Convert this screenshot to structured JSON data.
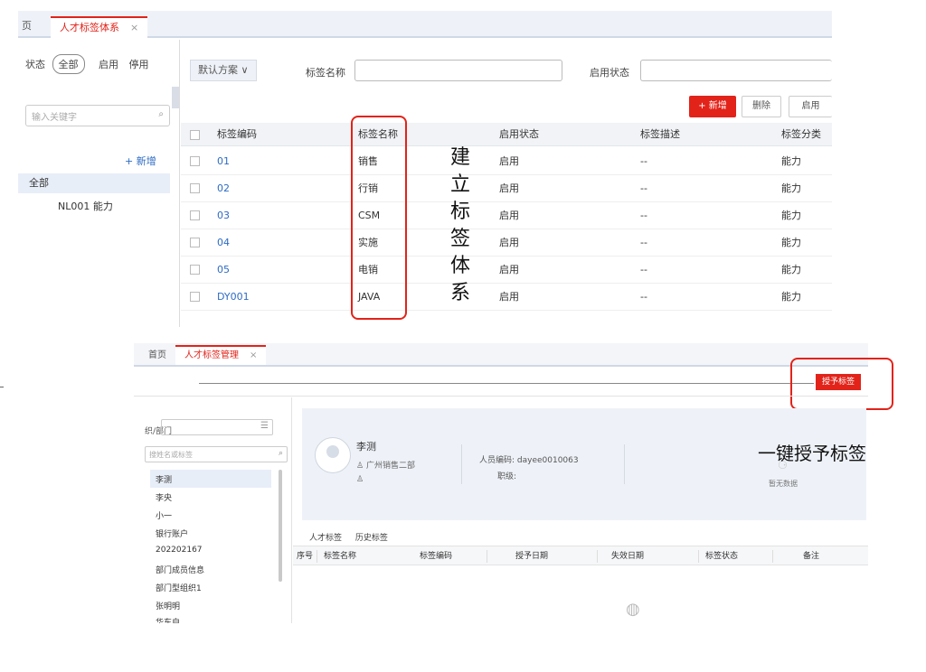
{
  "top": {
    "tabs": [
      {
        "label": "页"
      },
      {
        "label": "人才标签体系",
        "close": "×"
      }
    ],
    "sidebar": {
      "status_label": "状态",
      "status_options": [
        "全部",
        "启用",
        "停用"
      ],
      "search_placeholder": "输入关键字",
      "add_label": "+ 新增",
      "tree_root": "全部",
      "tree_child": "NL001 能力"
    },
    "filters": {
      "plan": "默认方案 ∨",
      "tag_name_label": "标签名称",
      "status_label": "启用状态"
    },
    "toolbar": {
      "new_label": "+ 新增",
      "delete_label": "删除",
      "enable_label": "启用"
    },
    "table": {
      "headers": [
        "标签编码",
        "标签名称",
        "启用状态",
        "标签描述",
        "标签分类"
      ],
      "rows": [
        {
          "code": "01",
          "name": "销售",
          "status": "启用",
          "desc": "--",
          "category": "能力"
        },
        {
          "code": "02",
          "name": "行销",
          "status": "启用",
          "desc": "--",
          "category": "能力"
        },
        {
          "code": "03",
          "name": "CSM",
          "status": "启用",
          "desc": "--",
          "category": "能力"
        },
        {
          "code": "04",
          "name": "实施",
          "status": "启用",
          "desc": "--",
          "category": "能力"
        },
        {
          "code": "05",
          "name": "电销",
          "status": "启用",
          "desc": "--",
          "category": "能力"
        },
        {
          "code": "DY001",
          "name": "JAVA",
          "status": "启用",
          "desc": "--",
          "category": "能力"
        }
      ]
    },
    "annotation_vertical": [
      "建",
      "立",
      "标",
      "签",
      "体",
      "系"
    ]
  },
  "bottom": {
    "tabs": [
      {
        "label": "首页"
      },
      {
        "label": "人才标签管理",
        "close": "×"
      }
    ],
    "grant_button": "授予标签",
    "sidebar": {
      "dept_label": "织/部门",
      "search_placeholder": "搜姓名或标签",
      "people": [
        "李测",
        "李央",
        "小一",
        "银行账户",
        "202202167",
        "部门成员信息",
        "部门型组织1",
        "张明明",
        "华东自"
      ]
    },
    "profile": {
      "name": "李测",
      "dept": "广州销售二部",
      "code": "人员编码: dayee0010063",
      "level": "职级:",
      "no_data": "暂无数据"
    },
    "tabs2": [
      "人才标签",
      "历史标签"
    ],
    "table_headers": [
      "序号",
      "标签名称",
      "标签编码",
      "授予日期",
      "失效日期",
      "标签状态",
      "备注"
    ],
    "annotation": "一键授予标签"
  },
  "colors": {
    "accent": "#e2231a",
    "link": "#2d6bc4"
  }
}
